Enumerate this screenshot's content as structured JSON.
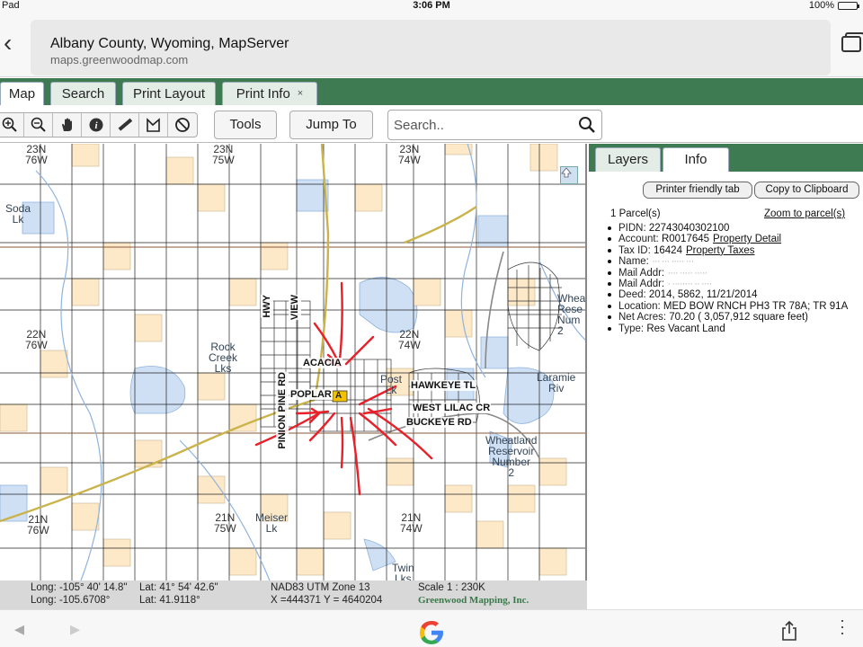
{
  "status_bar": {
    "carrier": "Pad",
    "time": "3:06 PM",
    "battery": "100%"
  },
  "browser": {
    "page_title": "Albany County, Wyoming, MapServer",
    "url": "maps.greenwoodmap.com"
  },
  "app_tabs": [
    {
      "label": "Map",
      "active": true
    },
    {
      "label": "Search",
      "active": false
    },
    {
      "label": "Print Layout",
      "active": false
    },
    {
      "label": "Print Info",
      "active": false,
      "close_glyph": "×"
    }
  ],
  "toolbar": {
    "tool_icons": [
      "zoom-in-icon",
      "zoom-out-icon",
      "pan-hand-icon",
      "info-icon",
      "measure-ruler-icon",
      "measure-area-icon",
      "clear-icon"
    ],
    "tools_label": "Tools",
    "jump_label": "Jump To",
    "search_placeholder": "Search.."
  },
  "map": {
    "labels": {
      "t1": "23N\n76W",
      "t2": "23N\n75W",
      "t3": "23N\n74W",
      "t4": "22N\n76W",
      "t5": "22N\n74W",
      "t6": "21N\n76W",
      "t7": "21N\n75W",
      "t8": "21N\n74W",
      "soda": "Soda\nLk",
      "rock": "Rock\nCreek\nLks",
      "post": "Post\nLk",
      "meiser": "Meiser\nLk",
      "twin": "Twin\nLks",
      "wheatland": "Wheatland\nReservoir\nNumber\n2",
      "laramie": "Laramie\nRiv",
      "whea": "Whea\nRese\nNum\n2",
      "acacia": "ACACIA",
      "poplar": "POPLAR",
      "hawkeye": "HAWKEYE TL",
      "westlilac": "WEST LILAC CR",
      "buckeye": "BUCKEYE RD",
      "pinion": "PINION PINE RD",
      "hwy": "HWY",
      "view": "VIEW"
    },
    "parcel_marker": "A"
  },
  "map_status": {
    "long_dms": "Long: -105° 40' 14.8\"",
    "lat_dms": "Lat: 41° 54' 42.6\"",
    "long_dec": "Long: -105.6708°",
    "lat_dec": "Lat: 41.9118°",
    "datum": "NAD83 UTM Zone 13",
    "xy": "X =444371 Y = 4640204",
    "scale": "Scale 1 : 230K",
    "brand": "Greenwood Mapping, Inc."
  },
  "panel": {
    "tabs": [
      {
        "label": "Layers",
        "active": false
      },
      {
        "label": "Info",
        "active": true
      }
    ],
    "printer_btn": "Printer friendly tab",
    "clipboard_btn": "Copy to Clipboard",
    "parcel_count": "1 Parcel(s)",
    "zoom_link": "Zoom to parcel(s)",
    "fields": [
      {
        "label": "PIDN:",
        "value": "22743040302100"
      },
      {
        "label": "Account:",
        "value": "R0017645",
        "link": "Property Detail"
      },
      {
        "label": "Tax ID:",
        "value": "16424",
        "link": "Property Taxes"
      },
      {
        "label": "Name:",
        "value": "··· ···  ····· ···"
      },
      {
        "label": "Mail Addr:",
        "value": "····  ·····  ·····"
      },
      {
        "label": "Mail Addr:",
        "value": "·  ········  ·· ····"
      },
      {
        "label": "Deed:",
        "value": "2014, 5862, 11/21/2014"
      },
      {
        "label": "Location:",
        "value": "MED BOW RNCH PH3 TR 78A; TR 91A"
      },
      {
        "label": "Net Acres:",
        "value": "70.20 ( 3,057,912 square feet)"
      },
      {
        "label": "Type:",
        "value": "Res Vacant Land"
      }
    ]
  },
  "colors": {
    "brand_green": "#3e7a52",
    "parcel_fill": "#fde9c8",
    "water_fill": "#cfe0f5",
    "annotation_red": "#e8202a"
  }
}
